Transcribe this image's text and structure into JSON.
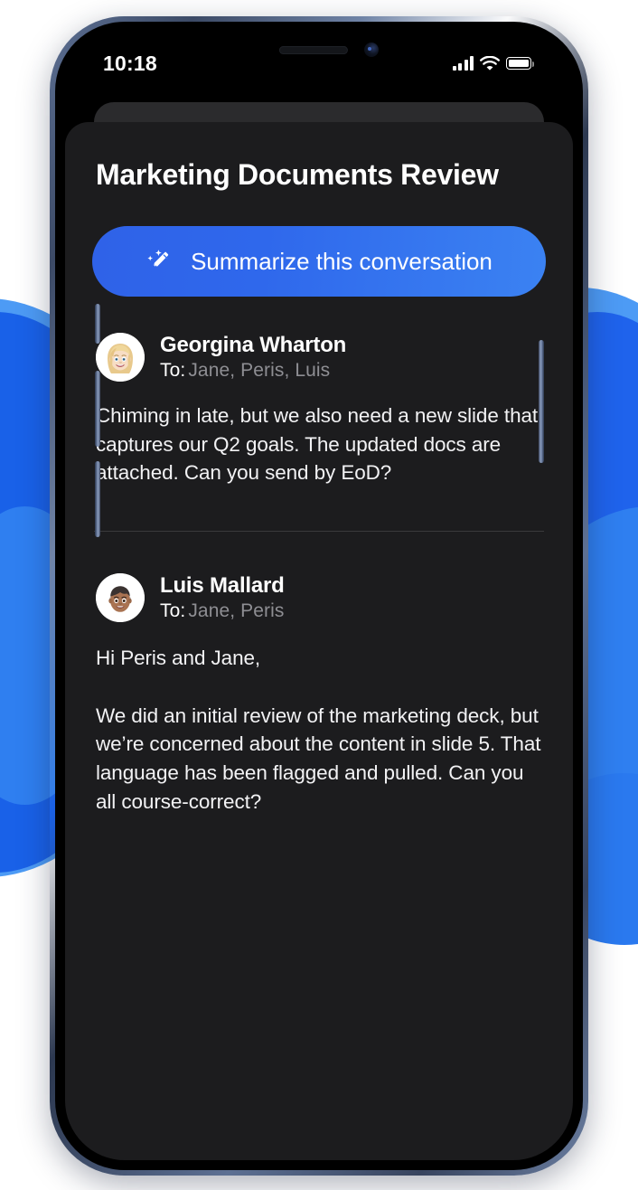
{
  "background": {
    "accent_blue_light": "#4d9bf5",
    "accent_blue_mid": "#2f7ff0",
    "accent_blue_dark": "#1961e8",
    "page_bg": "#ffffff"
  },
  "device": {
    "frame_color": "#4c5a78",
    "screen_bg": "#000000",
    "card_bg": "#1c1c1e",
    "card_back_bg": "#2b2b2d",
    "buttons": {
      "silent_switch": "silent-switch",
      "volume_up": "volume-up-button",
      "volume_down": "volume-down-button",
      "power": "power-button"
    }
  },
  "status_bar": {
    "time": "10:18",
    "cellular_bars": 4,
    "cellular_icon": "signal-bars-icon",
    "wifi_icon": "wifi-icon",
    "battery_icon": "battery-full-icon",
    "battery_level": 100
  },
  "header": {
    "title": "Marketing Documents Review"
  },
  "summarize": {
    "label": "Summarize this conversation",
    "icon": "magic-wand-sparkles-icon",
    "gradient_start": "#2f62e8",
    "gradient_end": "#3b82f2",
    "text_color": "#ffffff"
  },
  "messages": [
    {
      "sender": "Georgina Wharton",
      "avatar_icon": "memoji-avatar-blonde-woman",
      "to_label": "To:",
      "recipients": "Jane,  Peris,  Luis",
      "body": "Chiming in late, but we also need a new slide that captures our Q2 goals. The updated docs are attached. Can you send by EoD?"
    },
    {
      "sender": "Luis Mallard",
      "avatar_icon": "memoji-avatar-man",
      "to_label": "To:",
      "recipients": "Jane,  Peris",
      "body": "Hi Peris and Jane,\n\nWe did an initial review of the marketing deck, but we’re concerned about the content in slide 5. That language has been flagged and pulled. Can you all course-correct?"
    }
  ]
}
